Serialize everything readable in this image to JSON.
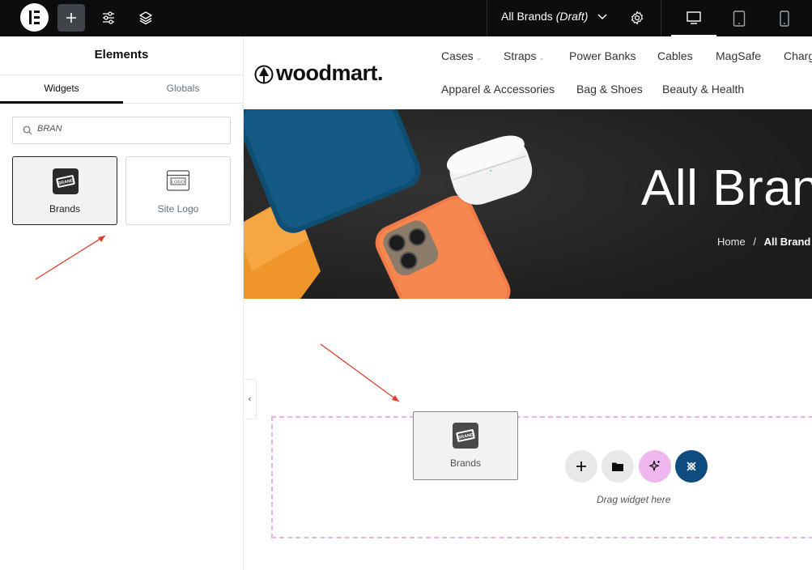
{
  "topbar": {
    "document_title": "All Brands",
    "document_status": "(Draft)"
  },
  "panel": {
    "title": "Elements",
    "tabs": [
      {
        "label": "Widgets"
      },
      {
        "label": "Globals"
      }
    ],
    "search": {
      "value": "BRAN"
    },
    "widgets": [
      {
        "label": "Brands"
      },
      {
        "label": "Site Logo"
      }
    ]
  },
  "site": {
    "logo_text": "woodmart.",
    "nav_row1": [
      {
        "label": "Cases"
      },
      {
        "label": "Straps"
      },
      {
        "label": "Power Banks"
      },
      {
        "label": "Cables"
      },
      {
        "label": "MagSafe"
      },
      {
        "label": "Charg"
      }
    ],
    "nav_row2": [
      {
        "label": "Apparel & Accessories"
      },
      {
        "label": "Bag & Shoes"
      },
      {
        "label": "Beauty & Health"
      }
    ],
    "hero": {
      "title": "All Bran",
      "breadcrumb_home": "Home",
      "breadcrumb_sep": "/",
      "breadcrumb_current": "All Brand"
    }
  },
  "dropzone": {
    "ghost_label": "Brands",
    "drag_text": "Drag widget here"
  },
  "colors": {
    "topbar": "#0c0d0e",
    "dropzone_border": "#eab1ea",
    "ai_button": "#f0b6f0",
    "elementor_button": "#0e4b7e",
    "annotation_arrow": "#e23c2c"
  }
}
